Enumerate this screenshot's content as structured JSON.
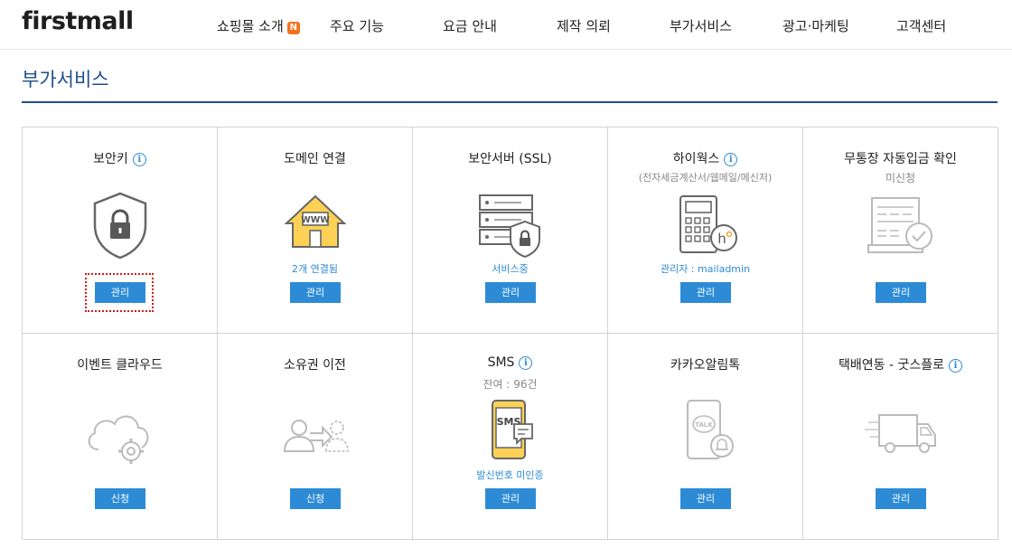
{
  "brand": {
    "logo": "firstmall"
  },
  "nav": {
    "items": [
      {
        "label": "쇼핑몰 소개",
        "badge": "N"
      },
      {
        "label": "주요 기능"
      },
      {
        "label": "요금 안내"
      },
      {
        "label": "제작 의뢰"
      },
      {
        "label": "부가서비스"
      },
      {
        "label": "광고·마케팅"
      },
      {
        "label": "고객센터"
      }
    ]
  },
  "page": {
    "title": "부가서비스"
  },
  "colors": {
    "accent": "#2d8bd6",
    "title": "#1f4e8c",
    "icon_yellow": "#fcd156",
    "badge": "#f2731d"
  },
  "services": [
    {
      "title": "보안키",
      "info": "i",
      "icon": "shield-lock-icon",
      "button": "관리"
    },
    {
      "title": "도메인 연결",
      "icon": "www-house-icon",
      "status": "2개 연결됨",
      "button": "관리"
    },
    {
      "title": "보안서버 (SSL)",
      "icon": "server-shield-icon",
      "status": "서비스중",
      "button": "관리"
    },
    {
      "title": "하이웍스",
      "info": "i",
      "subtitle": "(전자세금계산서/웹메일/메신저)",
      "icon": "calculator-hiworks-icon",
      "status": "관리자 : mailadmin",
      "button": "관리"
    },
    {
      "title": "무통장 자동입금 확인",
      "subtitle": "미신청",
      "icon": "bank-deposit-check-icon",
      "button": "관리"
    },
    {
      "title": "이벤트 클라우드",
      "icon": "cloud-gear-icon",
      "button": "신청"
    },
    {
      "title": "소유권 이전",
      "icon": "ownership-transfer-icon",
      "button": "신청"
    },
    {
      "title": "SMS",
      "info": "i",
      "subtitle": "잔여 : 96건",
      "icon": "sms-phone-icon",
      "icon_text": "SMS",
      "status": "발신번호 미인증",
      "button": "관리"
    },
    {
      "title": "카카오알림톡",
      "icon": "kakao-talk-phone-icon",
      "icon_text": "TALK",
      "button": "관리"
    },
    {
      "title": "택배연동 - 굿스플로",
      "info": "i",
      "icon": "delivery-truck-icon",
      "button": "관리"
    }
  ]
}
